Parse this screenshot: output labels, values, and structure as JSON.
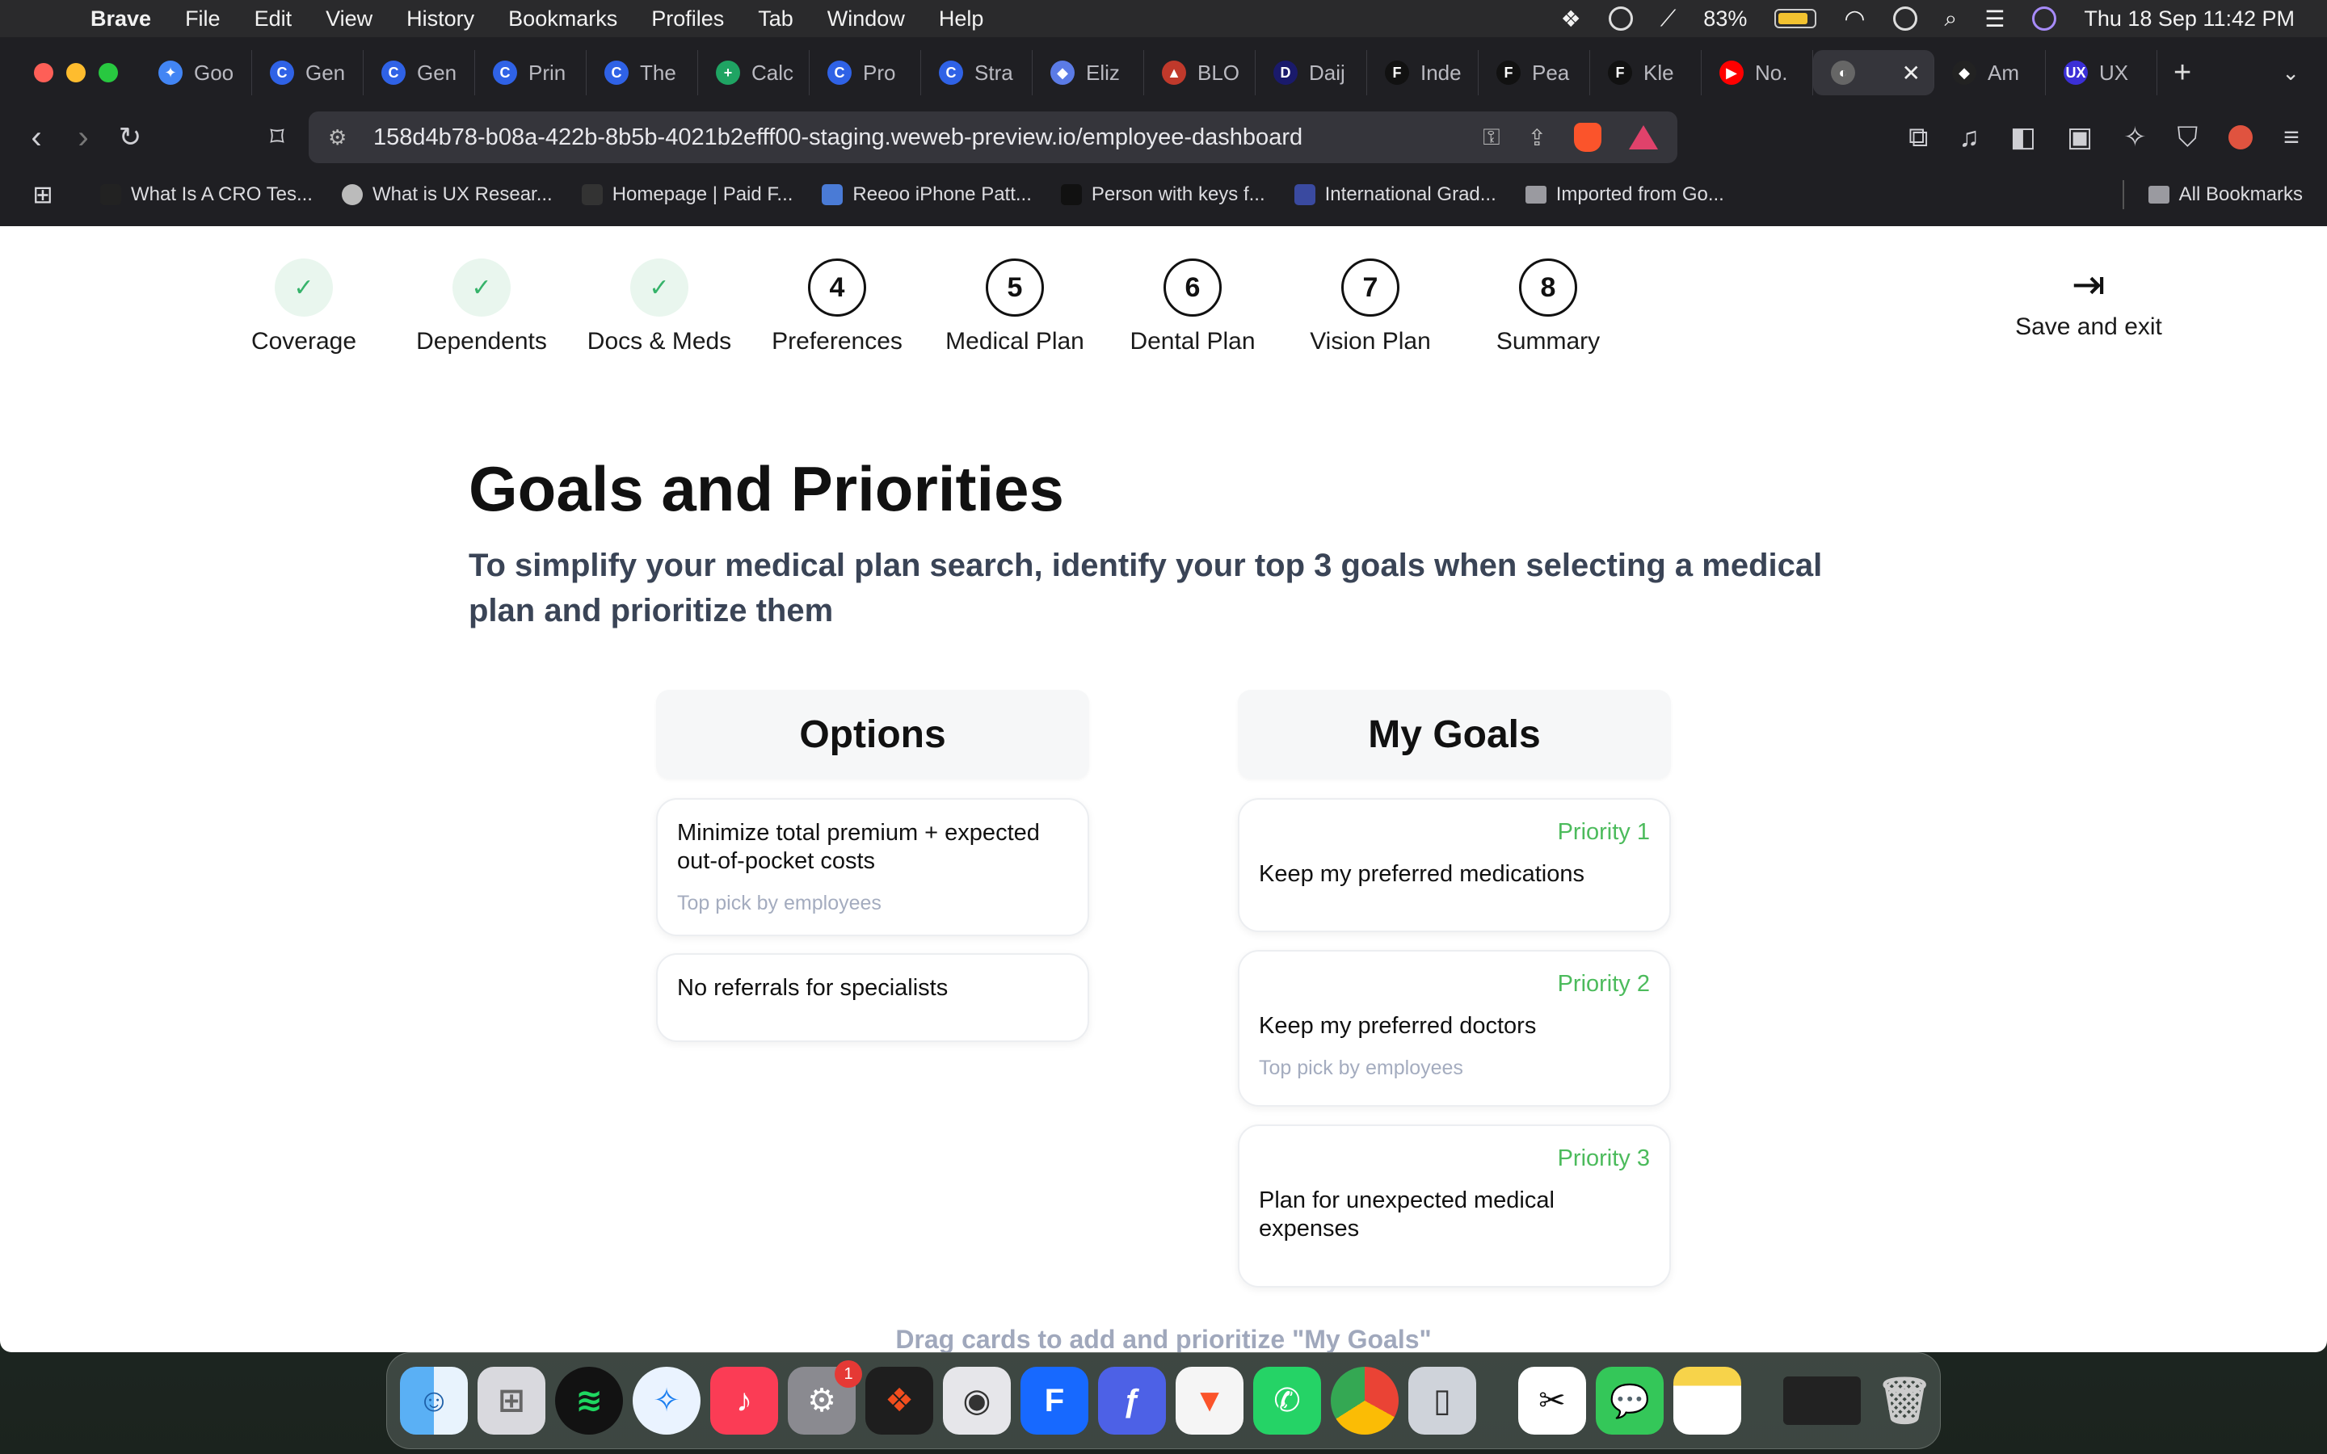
{
  "menubar": {
    "app": "Brave",
    "items": [
      "File",
      "Edit",
      "View",
      "History",
      "Bookmarks",
      "Profiles",
      "Tab",
      "Window",
      "Help"
    ],
    "battery": "83%",
    "datetime": "Thu 18 Sep  11:42 PM"
  },
  "tabs": [
    {
      "label": "Goo",
      "color": "#4285f4",
      "glyph": "✦"
    },
    {
      "label": "Gen",
      "color": "#2f62e6",
      "glyph": "C"
    },
    {
      "label": "Gen",
      "color": "#2f62e6",
      "glyph": "C"
    },
    {
      "label": "Prin",
      "color": "#2f62e6",
      "glyph": "C"
    },
    {
      "label": "The",
      "color": "#2f62e6",
      "glyph": "C"
    },
    {
      "label": "Calc",
      "color": "#1fa463",
      "glyph": "+"
    },
    {
      "label": "Pro",
      "color": "#2f62e6",
      "glyph": "C"
    },
    {
      "label": "Stra",
      "color": "#2f62e6",
      "glyph": "C"
    },
    {
      "label": "Eliz",
      "color": "#5b7be6",
      "glyph": "◆"
    },
    {
      "label": "BLO",
      "color": "#c0392b",
      "glyph": "▲"
    },
    {
      "label": "Daij",
      "color": "#1a1a6b",
      "glyph": "D"
    },
    {
      "label": "Inde",
      "color": "#111111",
      "glyph": "F"
    },
    {
      "label": "Pea",
      "color": "#111111",
      "glyph": "F"
    },
    {
      "label": "Kle",
      "color": "#111111",
      "glyph": "F"
    },
    {
      "label": "No.",
      "color": "#ff0000",
      "glyph": "▶"
    },
    {
      "label": "",
      "color": "#666666",
      "glyph": "◐"
    },
    {
      "label": "Am",
      "color": "#222222",
      "glyph": "◆"
    },
    {
      "label": "UX",
      "color": "#3b2fd6",
      "glyph": "UX"
    }
  ],
  "toolbar": {
    "url": "158d4b78-b08a-422b-8b5b-4021b2efff00-staging.weweb-preview.io/employee-dashboard"
  },
  "bookmarks": [
    "What Is A CRO Tes...",
    "What is UX Resear...",
    "Homepage | Paid F...",
    "Reeoo iPhone Patt...",
    "Person with keys f...",
    "International Grad...",
    "Imported from Go..."
  ],
  "bookmarks_all": "All Bookmarks",
  "stepper": {
    "steps": [
      {
        "label": "Coverage",
        "mark": "✓",
        "status": "done"
      },
      {
        "label": "Dependents",
        "mark": "✓",
        "status": "done"
      },
      {
        "label": "Docs & Meds",
        "mark": "✓",
        "status": "done"
      },
      {
        "label": "Preferences",
        "mark": "4",
        "status": "current"
      },
      {
        "label": "Medical Plan",
        "mark": "5",
        "status": "todo"
      },
      {
        "label": "Dental Plan",
        "mark": "6",
        "status": "todo"
      },
      {
        "label": "Vision Plan",
        "mark": "7",
        "status": "todo"
      },
      {
        "label": "Summary",
        "mark": "8",
        "status": "todo"
      }
    ],
    "save_exit": "Save and exit"
  },
  "main": {
    "title": "Goals and Priorities",
    "subtitle": "To simplify your medical plan search, identify your top 3 goals when selecting a medical plan and prioritize them",
    "options_title": "Options",
    "goals_title": "My Goals",
    "options": [
      {
        "text": "Minimize total premium + expected out-of-pocket costs",
        "tag": "Top pick by employees"
      },
      {
        "text": "No referrals for specialists",
        "tag": ""
      }
    ],
    "goals": [
      {
        "priority": "Priority 1",
        "text": "Keep my preferred medications",
        "tag": ""
      },
      {
        "priority": "Priority 2",
        "text": "Keep my preferred doctors",
        "tag": "Top pick by employees"
      },
      {
        "priority": "Priority 3",
        "text": "Plan for unexpected medical expenses",
        "tag": ""
      }
    ],
    "drag_hint": "Drag cards to add and prioritize \"My Goals\""
  },
  "dock": {
    "notification_badge": "1"
  }
}
